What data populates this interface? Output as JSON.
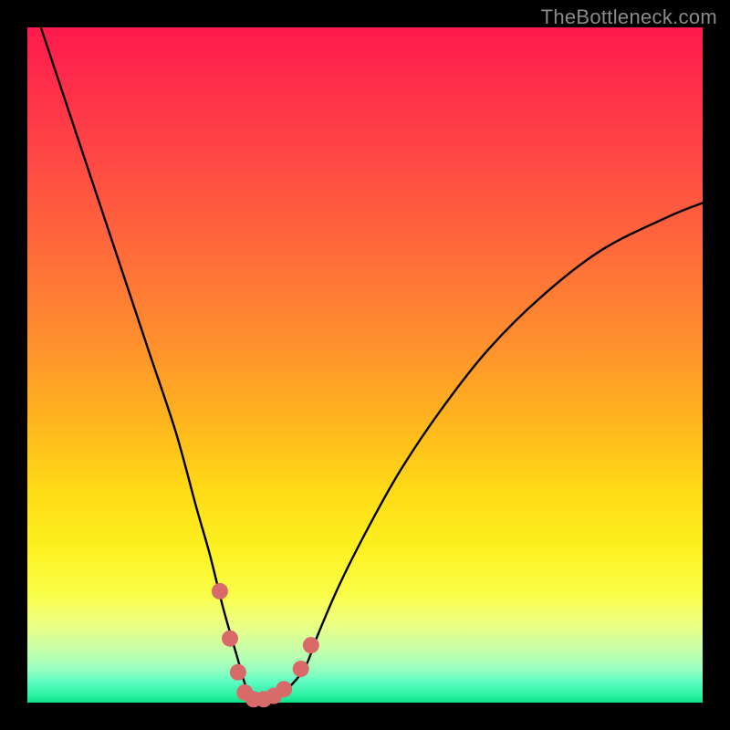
{
  "watermark": "TheBottleneck.com",
  "colors": {
    "background": "#000000",
    "curve": "#000000",
    "dots": "#d96a6a"
  },
  "chart_data": {
    "type": "line",
    "title": "",
    "xlabel": "",
    "ylabel": "",
    "xlim": [
      0,
      100
    ],
    "ylim": [
      0,
      100
    ],
    "x": [
      2,
      6,
      10,
      14,
      18,
      22,
      25,
      27,
      29,
      31,
      32.5,
      34,
      36,
      38,
      41,
      43,
      46,
      50,
      55,
      61,
      68,
      76,
      85,
      95,
      100
    ],
    "values": [
      100,
      88,
      76,
      64,
      52,
      40,
      29,
      22,
      14,
      7,
      2,
      0,
      0,
      1.5,
      5,
      10,
      17,
      25,
      34,
      43,
      52,
      60,
      67,
      72,
      74
    ],
    "series": [
      {
        "name": "bottleneck-curve",
        "x": [
          2,
          6,
          10,
          14,
          18,
          22,
          25,
          27,
          29,
          31,
          32.5,
          34,
          36,
          38,
          41,
          43,
          46,
          50,
          55,
          61,
          68,
          76,
          85,
          95,
          100
        ],
        "values": [
          100,
          88,
          76,
          64,
          52,
          40,
          29,
          22,
          14,
          7,
          2,
          0,
          0,
          1.5,
          5,
          10,
          17,
          25,
          34,
          43,
          52,
          60,
          67,
          72,
          74
        ]
      },
      {
        "name": "highlight-dots",
        "x": [
          28.5,
          30.0,
          31.2,
          32.2,
          33.5,
          35.0,
          36.5,
          38.0,
          40.5,
          42.0
        ],
        "values": [
          16.5,
          9.5,
          4.5,
          1.5,
          0.5,
          0.5,
          1.0,
          2.0,
          5.0,
          8.5
        ]
      }
    ]
  }
}
